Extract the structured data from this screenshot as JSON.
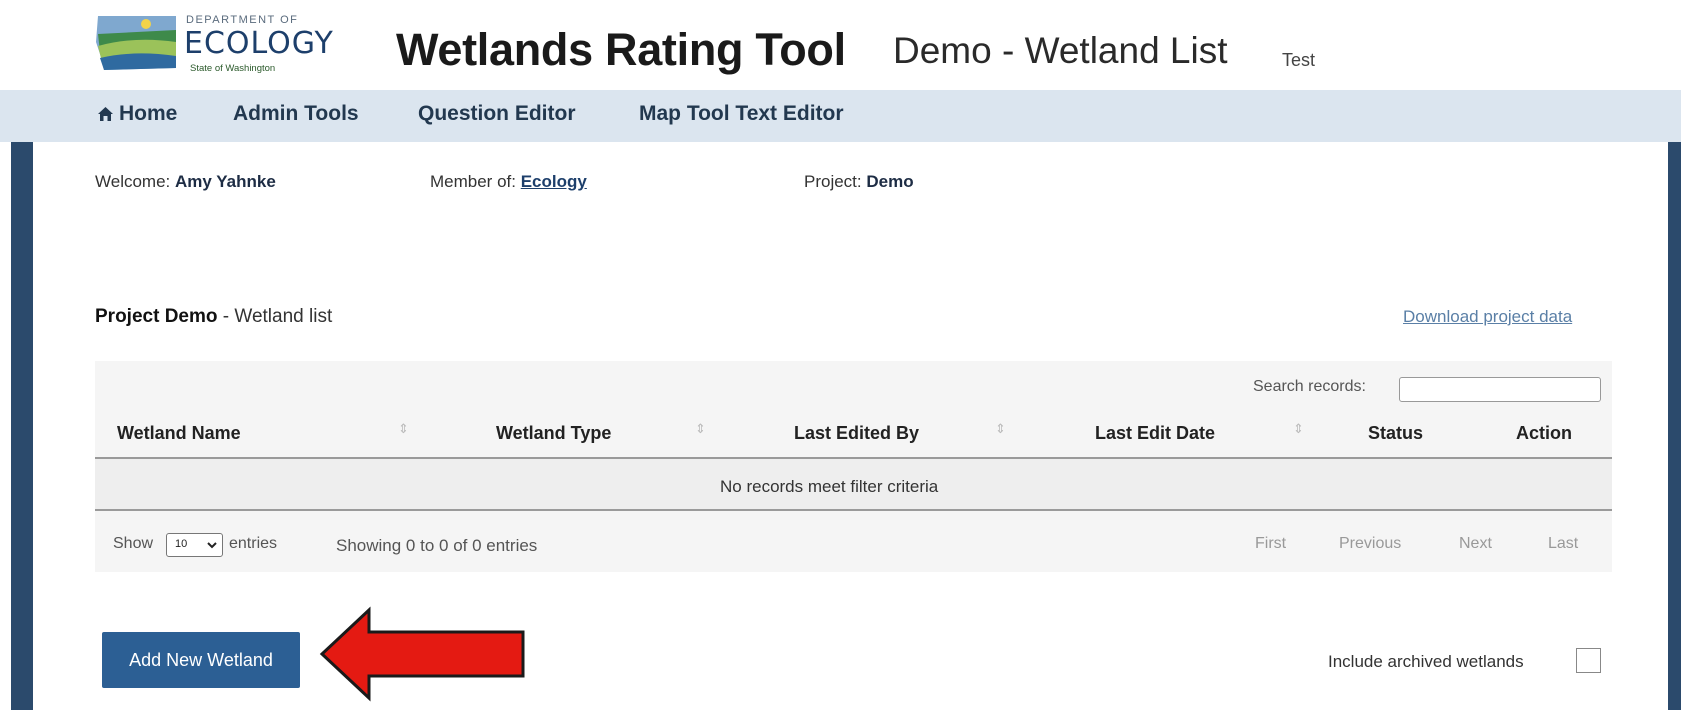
{
  "header": {
    "logo": {
      "dept_line": "DEPARTMENT OF",
      "name": "ECOLOGY",
      "state_line": "State of Washington"
    },
    "app_title": "Wetlands Rating Tool",
    "page_title": "Demo - Wetland List",
    "env_tag": "Test"
  },
  "nav": {
    "items": [
      {
        "label": "Home",
        "icon": "home-icon"
      },
      {
        "label": "Admin Tools"
      },
      {
        "label": "Question Editor"
      },
      {
        "label": "Map Tool Text Editor"
      }
    ]
  },
  "info": {
    "welcome_label": "Welcome:",
    "welcome_user": "Amy Yahnke",
    "member_label": "Member of:",
    "member_org": "Ecology",
    "project_label": "Project:",
    "project_name": "Demo"
  },
  "section": {
    "title_bold": "Project Demo",
    "title_rest": "- Wetland list",
    "download_link": "Download project data"
  },
  "table": {
    "search_label": "Search records:",
    "search_value": "",
    "columns": [
      "Wetland Name",
      "Wetland Type",
      "Last Edited By",
      "Last Edit Date",
      "Status",
      "Action"
    ],
    "empty_message": "No records meet filter criteria",
    "show_label": "Show",
    "entries_selected": "10",
    "entries_label": "entries",
    "showing_text": "Showing 0 to 0 of 0 entries",
    "pager": [
      "First",
      "Previous",
      "Next",
      "Last"
    ]
  },
  "actions": {
    "add_button": "Add New Wetland",
    "archive_label": "Include archived wetlands",
    "archive_checked": false
  },
  "colors": {
    "nav_bg": "#dbe5ef",
    "side_bar": "#2b4a6c",
    "button_bg": "#2c5f94",
    "arrow": "#e41a12"
  }
}
